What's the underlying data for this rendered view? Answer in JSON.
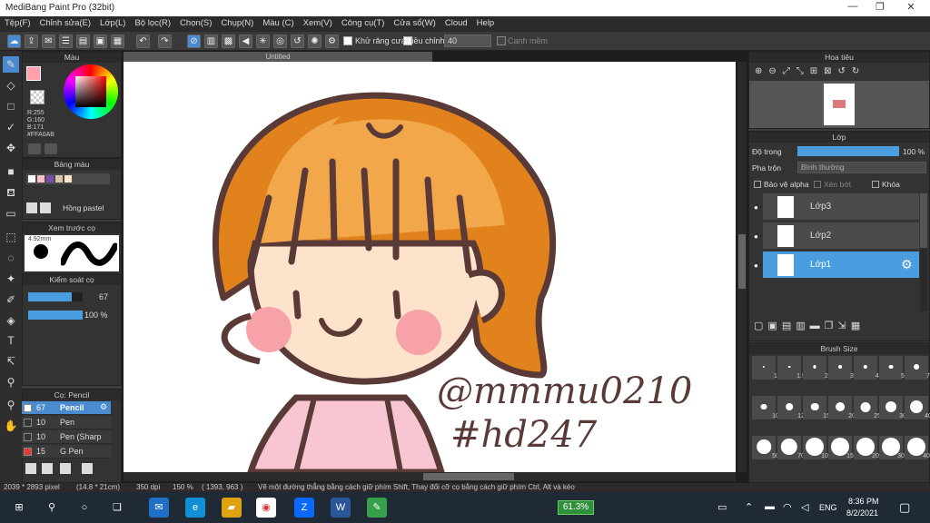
{
  "window": {
    "title": "MediBang Paint Pro (32bit)",
    "min": "—",
    "max": "❐",
    "close": "✕"
  },
  "menu": [
    "Tệp(F)",
    "Chỉnh sửa(E)",
    "Lớp(L)",
    "Bộ lọc(R)",
    "Chọn(S)",
    "Chụp(N)",
    "Màu (C)",
    "Xem(V)",
    "Công cụ(T)",
    "Cửa sổ(W)",
    "Cloud",
    "Help"
  ],
  "toolbar": {
    "antialias": "Khử răng cưa",
    "adjust": "Điều chỉnh",
    "adjust_value": "40",
    "margin": "Cạnh mềm"
  },
  "document": {
    "tab": "Untitled"
  },
  "color_panel": {
    "title": "Màu",
    "r": "R:255",
    "g": "G:160",
    "b": "B:171",
    "hex": "#FFA0AB",
    "primary": "#FFA0AB"
  },
  "palette_panel": {
    "title": "Bảng màu",
    "name": "Hồng pastel",
    "swatches": [
      "#ffffff",
      "#f5c2c9",
      "#7a4fa8",
      "#d8c6a8",
      "#f9e5c8"
    ]
  },
  "preview_panel": {
    "title": "Xem trước cọ",
    "size": "4.92mm"
  },
  "control_panel": {
    "title": "Kiểm soát cọ",
    "size": "67",
    "opacity": "100 %",
    "size_frac": 0.8,
    "opacity_frac": 1.0
  },
  "brush_panel": {
    "title": "Cọ: Pencil",
    "items": [
      {
        "size": "67",
        "name": "Pencil",
        "color": "#ffffff"
      },
      {
        "size": "10",
        "name": "Pen",
        "color": "#333333"
      },
      {
        "size": "10",
        "name": "Pen (Sharp",
        "color": "#333333"
      },
      {
        "size": "15",
        "name": "G Pen",
        "color": "#e53935"
      }
    ]
  },
  "navigator": {
    "title": "Hoa tiêu"
  },
  "layer_panel": {
    "title": "Lớp",
    "opacity_label": "Độ trong",
    "opacity_value": "100 %",
    "blend_label": "Pha trộn",
    "blend_value": "Bình thường",
    "protect_alpha": "Bảo vệ alpha",
    "clip": "Xén bớt",
    "lock": "Khóa",
    "layers": [
      {
        "name": "Lớp3"
      },
      {
        "name": "Lớp2"
      },
      {
        "name": "Lớp1"
      }
    ]
  },
  "brushsize_panel": {
    "title": "Brush Size",
    "sizes": [
      "1",
      "1.5",
      "2",
      "3",
      "4",
      "5",
      "7",
      "10",
      "12",
      "15",
      "20",
      "25",
      "30",
      "40",
      "50",
      "70",
      "100",
      "150",
      "200",
      "300",
      "400",
      "500"
    ]
  },
  "status": {
    "dims": "2039 * 2893 pixel",
    "physical": "(14.8 * 21cm)",
    "dpi": "350 dpi",
    "zoom": "150 %",
    "coords": "( 1393, 963 )",
    "hint": "Vẽ một đường thẳng bằng cách giữ phím Shift, Thay đổi cỡ cọ bằng cách giữ phím Ctrl, Alt và kéo"
  },
  "taskbar": {
    "battery": "61.3%",
    "lang": "ENG",
    "time": "8:36 PM",
    "date": "8/2/2021"
  },
  "drawing": {
    "signature_line1": "@mmmu0210",
    "signature_line2": "#hd247"
  }
}
